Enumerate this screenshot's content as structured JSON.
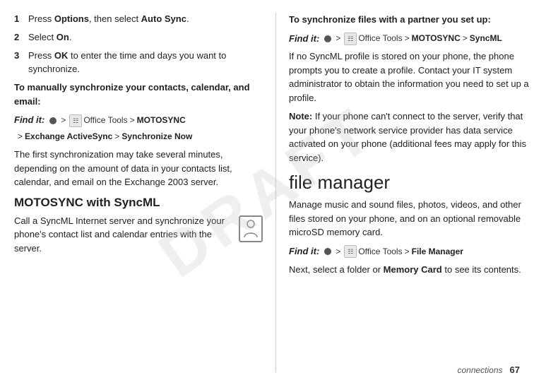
{
  "left": {
    "step1": {
      "num": "1",
      "text": "Press ",
      "bold": "Options",
      "text2": ", then select ",
      "bold2": "Auto Sync",
      "text3": "."
    },
    "step2": {
      "num": "2",
      "text": "Select ",
      "bold": "On",
      "text2": "."
    },
    "step3": {
      "num": "3",
      "text": "Press ",
      "bold": "OK",
      "text2": " to enter the time and days you want to synchronize."
    },
    "manually_heading": "To manually synchronize your contacts, calendar, and email:",
    "find_it_label": "Find it:",
    "find_it_nav1": "Office Tools",
    "find_it_nav2": "MOTOSYNC",
    "find_it_nav3": "Exchange ActiveSync",
    "find_it_nav4": "Synchronize Now",
    "first_sync_text": "The first synchronization may take several minutes, depending on the amount of data in your contacts list, calendar, and email on the Exchange 2003 server.",
    "motosync_heading": "MOTOSYNC with SyncML",
    "motosync_body": "Call a SyncML Internet server and synchronize your phone's contact list and calendar entries with the server."
  },
  "right": {
    "sync_partner_heading": "To synchronize files with a partner you set up:",
    "find_it_label": "Find it:",
    "find_it_nav1": "Office Tools",
    "find_it_nav2": "MOTOSYNC",
    "find_it_nav3": "SyncML",
    "syncml_body": "If no SyncML profile is stored on your phone, the phone prompts you to create a profile. Contact your IT system administrator to obtain the information you need to set up a profile.",
    "note_label": "Note:",
    "note_text": " If your phone can't connect to the server, verify that your phone's network service provider has data service activated on your phone (additional fees may apply for this service).",
    "file_manager_heading": "file manager",
    "file_manager_body": "Manage music and sound files, photos, videos, and other files stored on your phone, and on an optional removable microSD memory card.",
    "find_it_label2": "Find it:",
    "find_it_fm_nav1": "Office Tools",
    "find_it_fm_nav2": "File Manager",
    "next_text": "Next, select a folder or ",
    "memory_card": "Memory Card",
    "next_text2": " to see its contents."
  },
  "footer": {
    "connections": "connections",
    "page_num": "67"
  },
  "watermark": "DRAFT"
}
